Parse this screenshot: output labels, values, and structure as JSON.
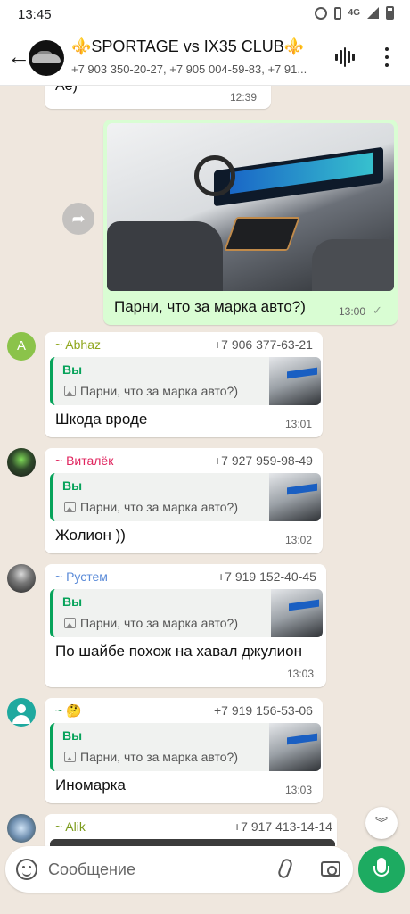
{
  "status_bar": {
    "time": "13:45",
    "network": "4G"
  },
  "header": {
    "back_label": "←",
    "group_name": "⚜️SPORTAGE vs IX35 CLUB⚜️",
    "members": "+7 903 350-20-27, +7 905 004-59-83, +7 91..."
  },
  "messages": {
    "prev": {
      "text": "Ае)",
      "time": "12:39"
    },
    "photo": {
      "caption": "Парни, что за марка авто?)",
      "time": "13:00",
      "status": "✓"
    },
    "replies": [
      {
        "avatar_letter": "A",
        "avatar_color": "#8bc34a",
        "sender": "~ Abhaz",
        "sender_color": "#8fa61c",
        "phone": "+7 906 377-63-21",
        "quote_name": "Вы",
        "quote_text": "Парни, что за марка авто?)",
        "text": "Шкода вроде",
        "time": "13:01"
      },
      {
        "avatar_letter": "",
        "avatar_color": "#3a5a40",
        "sender": "~ Виталёк",
        "sender_color": "#e0245e",
        "phone": "+7 927 959-98-49",
        "quote_name": "Вы",
        "quote_text": "Парни, что за марка авто?)",
        "text": "Жолион ))",
        "time": "13:02"
      },
      {
        "avatar_letter": "",
        "avatar_color": "#555555",
        "sender": "~ Рустем",
        "sender_color": "#5b8bd8",
        "phone": "+7 919 152-40-45",
        "quote_name": "Вы",
        "quote_text": "Парни, что за марка авто?)",
        "text": "По шайбе похож на хавал джулион",
        "time": "13:03"
      },
      {
        "avatar_letter": "",
        "avatar_color": "#1fa99f",
        "sender": "~ 🤔",
        "sender_color": "#1e9a5a",
        "phone": "+7 919 156-53-06",
        "quote_name": "Вы",
        "quote_text": "Парни, что за марка авто?)",
        "text": "Иномарка",
        "time": "13:03"
      }
    ],
    "partial": {
      "sender": "~ Alik",
      "sender_color": "#7a9a1a",
      "phone": "+7 917 413-14-14"
    }
  },
  "composer": {
    "placeholder": "Сообщение"
  },
  "colors": {
    "accent": "#1dab61",
    "out_bubble": "#d9fdd3",
    "chat_bg": "#efe7de",
    "quote_bar": "#06a35a"
  },
  "icons": [
    "back-arrow-icon",
    "voice-wave-icon",
    "more-vert-icon",
    "forward-icon",
    "image-icon",
    "emoji-icon",
    "attach-icon",
    "camera-icon",
    "mic-icon",
    "chevron-double-down-icon"
  ]
}
